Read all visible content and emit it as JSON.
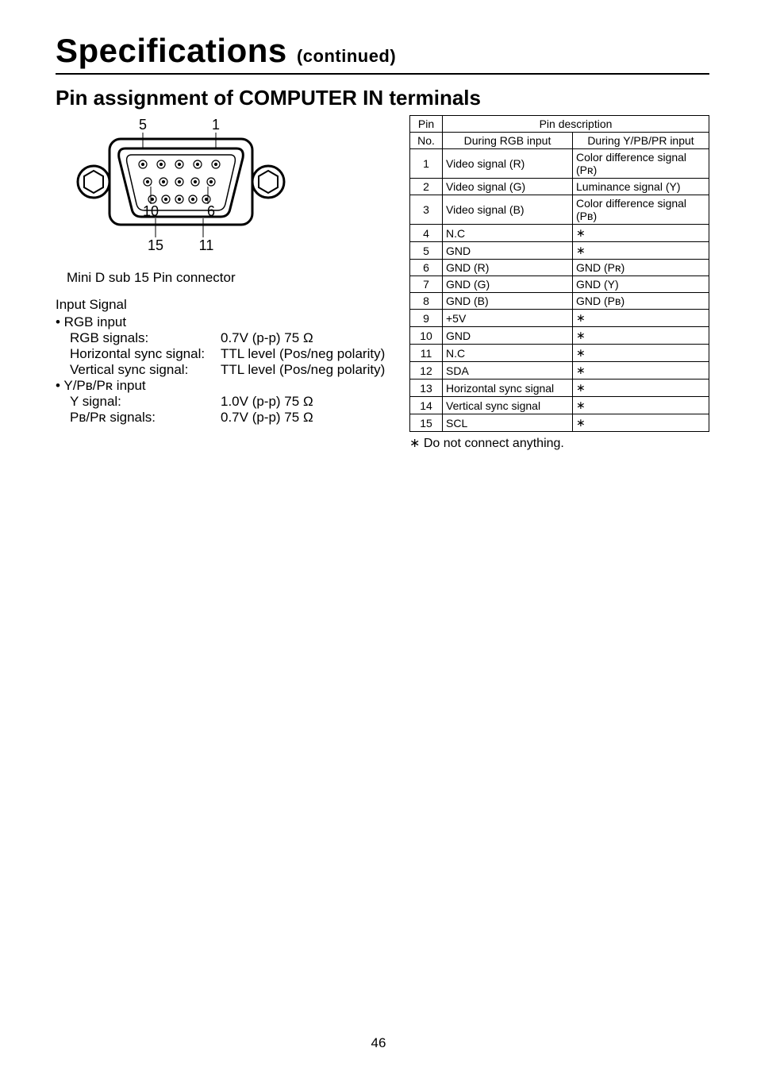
{
  "page_number": "46",
  "title_main": "Specifications",
  "title_cont": "(continued)",
  "section_title": "Pin assignment of COMPUTER IN terminals",
  "connector_caption": "Mini D sub 15 Pin connector",
  "diagram_labels": {
    "tl": "5",
    "tr": "1",
    "ml": "10",
    "mr": "6",
    "bl": "15",
    "br": "11"
  },
  "input_signal_heading": "Input Signal",
  "rgb_block": {
    "bullet": "• RGB input",
    "rows": [
      {
        "label": "RGB signals:",
        "value": "0.7V (p-p) 75 Ω"
      },
      {
        "label": "Horizontal sync signal:",
        "value": "TTL level (Pos/neg polarity)"
      },
      {
        "label": "Vertical sync signal:",
        "value": "TTL level (Pos/neg polarity)"
      }
    ]
  },
  "ypbpr_block": {
    "bullet": "• Y/Pʙ/Pʀ input",
    "rows": [
      {
        "label": "Y signal:",
        "value": "1.0V (p-p) 75 Ω"
      },
      {
        "label": "Pʙ/Pʀ signals:",
        "value": "0.7V (p-p) 75 Ω"
      }
    ]
  },
  "table": {
    "head_pin": "Pin",
    "head_desc": "Pin description",
    "head_no": "No.",
    "head_rgb": "During RGB input",
    "head_yp": "During Y/PB/PR input",
    "rows": [
      {
        "no": "1",
        "rgb": "Video signal (R)",
        "yp": "Color difference signal (Pʀ)"
      },
      {
        "no": "2",
        "rgb": "Video signal (G)",
        "yp": "Luminance signal (Y)"
      },
      {
        "no": "3",
        "rgb": "Video signal (B)",
        "yp": "Color difference signal (Pʙ)"
      },
      {
        "no": "4",
        "rgb": "N.C",
        "yp": "∗"
      },
      {
        "no": "5",
        "rgb": "GND",
        "yp": "∗"
      },
      {
        "no": "6",
        "rgb": "GND (R)",
        "yp": "GND (Pʀ)"
      },
      {
        "no": "7",
        "rgb": "GND (G)",
        "yp": "GND (Y)"
      },
      {
        "no": "8",
        "rgb": "GND (B)",
        "yp": "GND (Pʙ)"
      },
      {
        "no": "9",
        "rgb": "+5V",
        "yp": "∗"
      },
      {
        "no": "10",
        "rgb": "GND",
        "yp": "∗"
      },
      {
        "no": "11",
        "rgb": "N.C",
        "yp": "∗"
      },
      {
        "no": "12",
        "rgb": "SDA",
        "yp": "∗"
      },
      {
        "no": "13",
        "rgb": "Horizontal sync signal",
        "yp": "∗"
      },
      {
        "no": "14",
        "rgb": "Vertical sync signal",
        "yp": "∗"
      },
      {
        "no": "15",
        "rgb": "SCL",
        "yp": "∗"
      }
    ]
  },
  "footnote": "∗ Do not connect anything."
}
